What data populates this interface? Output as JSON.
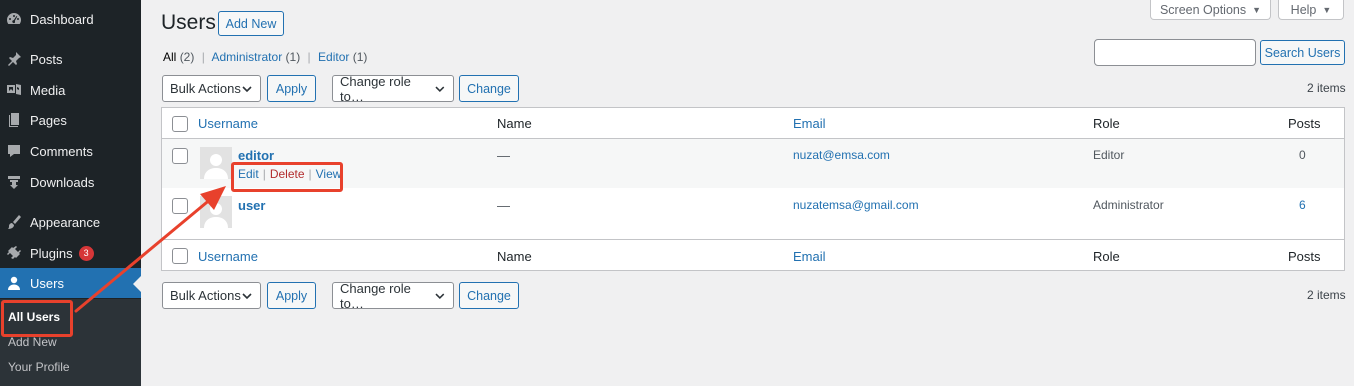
{
  "sidebar": {
    "items": [
      {
        "label": "Dashboard",
        "icon": "dashboard-icon"
      },
      {
        "label": "Posts",
        "icon": "pushpin-icon"
      },
      {
        "label": "Media",
        "icon": "media-icon"
      },
      {
        "label": "Pages",
        "icon": "pages-icon"
      },
      {
        "label": "Comments",
        "icon": "comment-icon"
      },
      {
        "label": "Downloads",
        "icon": "download-icon"
      },
      {
        "label": "Appearance",
        "icon": "paintbrush-icon"
      },
      {
        "label": "Plugins",
        "icon": "plugin-icon",
        "badge": "3"
      },
      {
        "label": "Users",
        "icon": "user-icon"
      }
    ],
    "submenu": {
      "all_users": "All Users",
      "add_new": "Add New",
      "your_profile": "Your Profile"
    }
  },
  "header": {
    "title": "Users",
    "add_new": "Add New",
    "screen_options": "Screen Options",
    "help": "Help"
  },
  "filters": {
    "all": "All",
    "all_count": "(2)",
    "administrator": "Administrator",
    "administrator_count": "(1)",
    "editor": "Editor",
    "editor_count": "(1)",
    "separator": "|"
  },
  "search": {
    "value": "",
    "button": "Search Users"
  },
  "bulk": {
    "actions": "Bulk Actions",
    "apply": "Apply",
    "change_role": "Change role to…",
    "change": "Change",
    "items_count": "2 items"
  },
  "table": {
    "columns": {
      "username": "Username",
      "name": "Name",
      "email": "Email",
      "role": "Role",
      "posts": "Posts"
    },
    "rows": [
      {
        "username": "editor",
        "name": "—",
        "email": "nuzat@emsa.com",
        "role": "Editor",
        "posts": "0"
      },
      {
        "username": "user",
        "name": "—",
        "email": "nuzatemsa@gmail.com",
        "role": "Administrator",
        "posts": "6"
      }
    ],
    "row_actions": {
      "edit": "Edit",
      "delete": "Delete",
      "view": "View",
      "separator": "|"
    }
  },
  "colors": {
    "sidebar_bg": "#1d2327",
    "accent": "#2271b1",
    "highlight": "#e8412c",
    "badge": "#d63638"
  }
}
